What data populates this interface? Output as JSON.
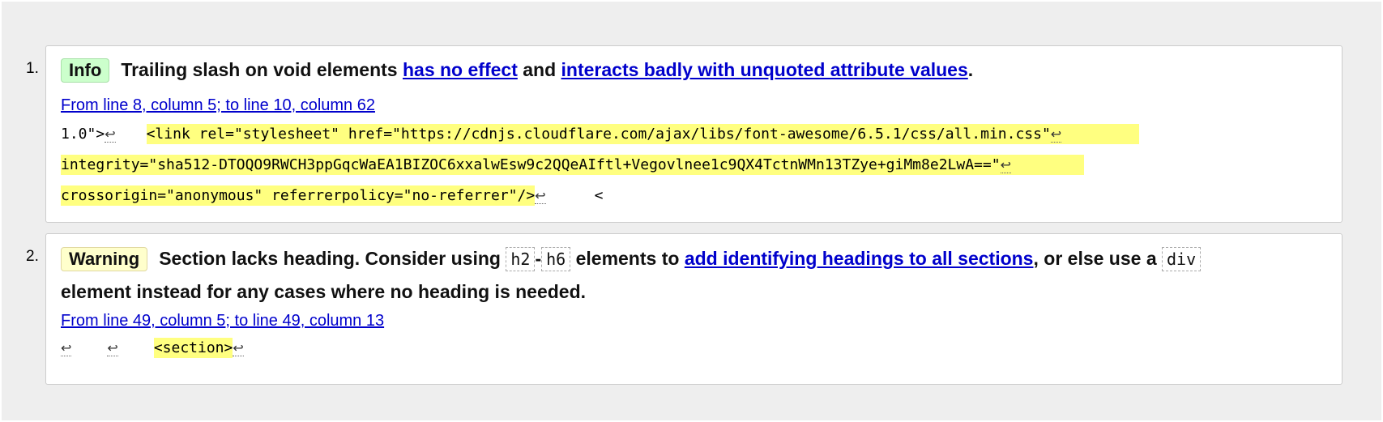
{
  "messages": [
    {
      "number": "1.",
      "type": "Info",
      "text_before": "Trailing slash on void elements ",
      "link1": "has no effect",
      "text_mid": " and ",
      "link2": "interacts badly with unquoted attribute values",
      "text_end": ".",
      "location": "From line 8, column 5; to line 10, column 62",
      "extract": {
        "line1_pre": "1.0\">",
        "line1_code": "<link rel=\"stylesheet\" href=\"https://cdnjs.cloudflare.com/ajax/libs/font-awesome/6.5.1/css/all.min.css\"",
        "line2_code": "integrity=\"sha512-DTOQO9RWCH3ppGqcWaEA1BIZOC6xxalwEsw9c2QQeAIftl+Vegovlnee1c9QX4TctnWMn13TZye+giMm8e2LwA==\"",
        "line3_code": "crossorigin=\"anonymous\" referrerpolicy=\"no-referrer\"/>",
        "line3_post": "<",
        "return_glyph": "↩"
      }
    },
    {
      "number": "2.",
      "type": "Warning",
      "text_before": "Section lacks heading. Consider using ",
      "code1": "h2",
      "dash": "-",
      "code2": "h6",
      "text_mid": " elements to ",
      "link1": "add identifying headings to all sections",
      "text_after": ", or else use a ",
      "code3": "div",
      "text_line2": "element instead for any cases where no heading is needed.",
      "location": "From line 49, column 5; to line 49, column 13",
      "extract": {
        "code": "<section>",
        "return_glyph": "↩"
      }
    }
  ],
  "colors": {
    "info_badge": "#ccffcc",
    "warning_badge": "#ffffcc",
    "highlight": "#ffff80",
    "link": "#0000cc"
  }
}
